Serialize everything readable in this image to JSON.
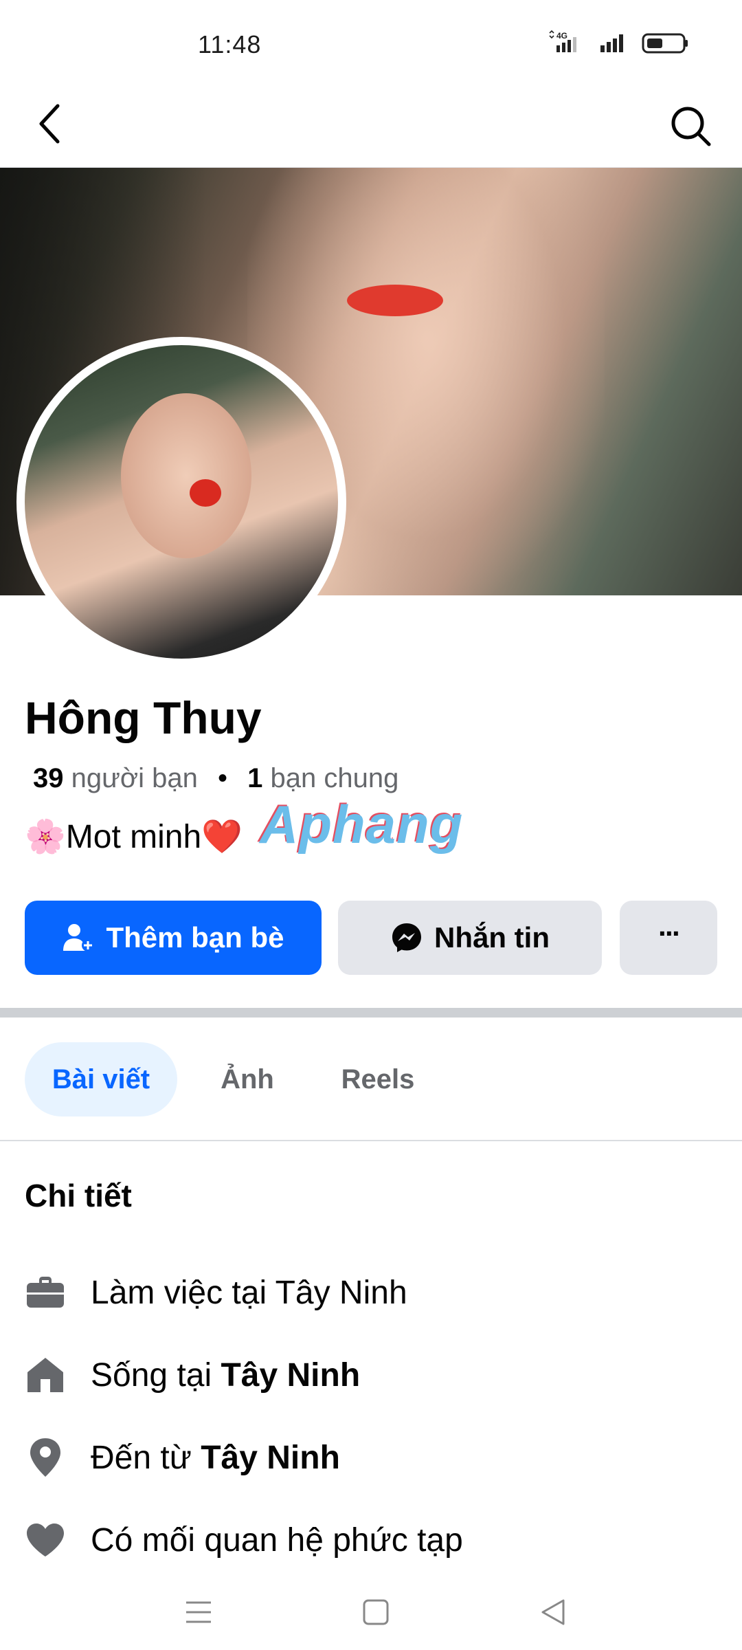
{
  "status": {
    "time": "11:48",
    "network": "4G"
  },
  "nav": {
    "back_icon": "chevron-left-icon",
    "search_icon": "search-icon"
  },
  "profile": {
    "name": "Hông Thuy",
    "friends_count": "39",
    "friends_label": "người bạn",
    "mutual_count": "1",
    "mutual_label": "bạn chung",
    "bio_prefix_emoji": "🌸",
    "bio_text": "Mot minh",
    "bio_suffix_emoji": "❤️",
    "watermark": "Aphang"
  },
  "actions": {
    "add_friend_label": "Thêm bạn bè",
    "message_label": "Nhắn tin",
    "more_label": "···"
  },
  "tabs": [
    {
      "label": "Bài viết",
      "active": true
    },
    {
      "label": "Ảnh",
      "active": false
    },
    {
      "label": "Reels",
      "active": false
    }
  ],
  "details": {
    "title": "Chi tiết",
    "items": [
      {
        "icon": "briefcase-icon",
        "text": "Làm việc tại Tây Ninh",
        "bold": ""
      },
      {
        "icon": "home-icon",
        "text": "Sống tại ",
        "bold": "Tây Ninh"
      },
      {
        "icon": "location-pin-icon",
        "text": "Đến từ ",
        "bold": "Tây Ninh"
      },
      {
        "icon": "heart-icon",
        "text": "Có mối quan hệ phức tạp",
        "bold": ""
      }
    ]
  },
  "colors": {
    "primary": "#0866ff",
    "secondary_bg": "#e4e6eb",
    "tab_active_bg": "#e7f3ff",
    "text": "#050505",
    "muted": "#65676b"
  }
}
